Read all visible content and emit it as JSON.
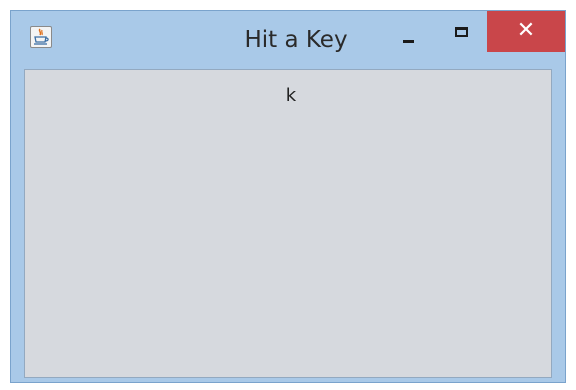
{
  "window": {
    "title": "Hit a Key",
    "app_icon": "java-coffee-cup-icon",
    "controls": {
      "minimize_icon": "minimize-icon",
      "maximize_icon": "maximize-icon",
      "close_icon": "close-icon",
      "close_glyph": "✕",
      "close_color": "#c9464a"
    }
  },
  "content": {
    "key_text": "k",
    "background": "#d6d9de"
  }
}
